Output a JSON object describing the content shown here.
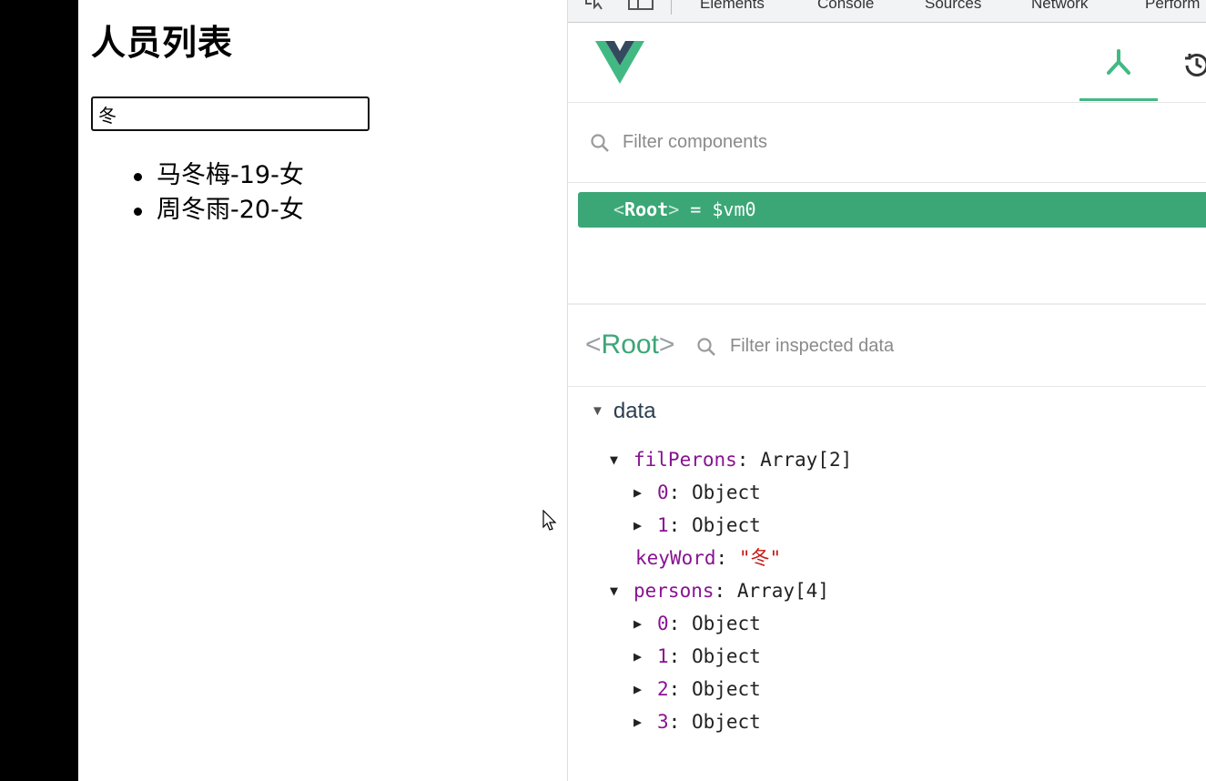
{
  "app": {
    "title": "人员列表",
    "search": {
      "value": "冬",
      "placeholder": ""
    },
    "list": [
      "马冬梅-19-女",
      "周冬雨-20-女"
    ]
  },
  "devtools": {
    "tabs": [
      "Elements",
      "Console",
      "Sources",
      "Network",
      "Perform"
    ],
    "vue": {
      "filter_components_placeholder": "Filter components",
      "root_row": {
        "open": "<",
        "name": "Root",
        "close": ">",
        "assign": " = $vm0"
      },
      "inspector": {
        "root_open": "<",
        "root_name": "Root",
        "root_close": ">",
        "filter_data_placeholder": "Filter inspected data",
        "section": "data",
        "fields": {
          "filPerons": {
            "key": "filPerons",
            "value": "Array[2]",
            "items": [
              {
                "key": "0",
                "value": "Object"
              },
              {
                "key": "1",
                "value": "Object"
              }
            ]
          },
          "keyWord": {
            "key": "keyWord",
            "value": "\"冬\""
          },
          "persons": {
            "key": "persons",
            "value": "Array[4]",
            "items": [
              {
                "key": "0",
                "value": "Object"
              },
              {
                "key": "1",
                "value": "Object"
              },
              {
                "key": "2",
                "value": "Object"
              },
              {
                "key": "3",
                "value": "Object"
              }
            ]
          }
        }
      }
    }
  },
  "colors": {
    "vue_green": "#42b983",
    "selected_row": "#3ba776",
    "key_purple": "#881391"
  },
  "icons": [
    "inspect-element-icon",
    "device-toggle-icon",
    "vue-logo",
    "component-tree-icon",
    "history-icon",
    "search-icon",
    "mouse-cursor"
  ]
}
